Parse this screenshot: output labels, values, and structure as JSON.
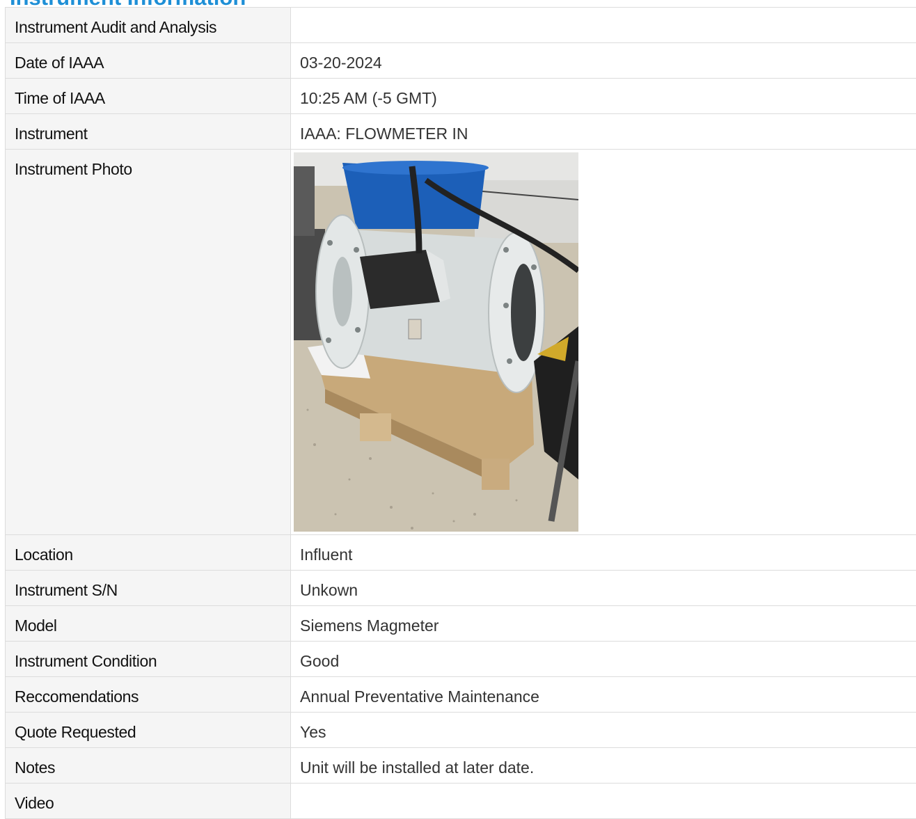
{
  "section": {
    "title": "Instrument Information"
  },
  "rows": [
    {
      "label": "Instrument Audit and Analysis",
      "value": ""
    },
    {
      "label": "Date of IAAA",
      "value": "03-20-2024"
    },
    {
      "label": "Time of IAAA",
      "value": "10:25 AM (-5 GMT)"
    },
    {
      "label": "Instrument",
      "value": "IAAA: FLOWMETER IN"
    },
    {
      "label": "Instrument Photo",
      "value": ""
    },
    {
      "label": "Location",
      "value": "Influent"
    },
    {
      "label": "Instrument S/N",
      "value": "Unkown"
    },
    {
      "label": "Model",
      "value": "Siemens Magmeter"
    },
    {
      "label": "Instrument Condition",
      "value": "Good"
    },
    {
      "label": "Reccomendations",
      "value": "Annual Preventative Maintenance"
    },
    {
      "label": "Quote Requested",
      "value": "Yes"
    },
    {
      "label": "Notes",
      "value": "Unit will be installed at later date."
    },
    {
      "label": "Video",
      "value": ""
    }
  ],
  "colors": {
    "title": "#1e8fd6",
    "label_bg": "#f5f5f5",
    "border": "#dcdcdc"
  }
}
